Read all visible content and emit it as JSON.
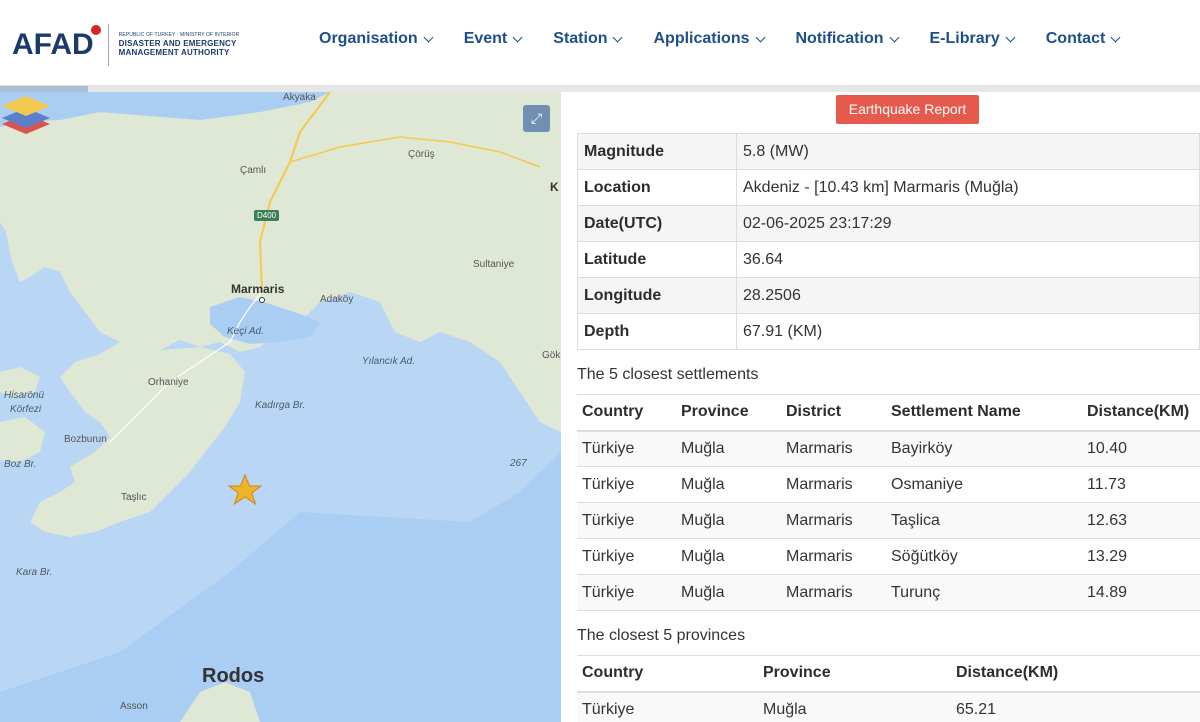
{
  "header": {
    "logo_text": "AFAD",
    "logo_line1": "REPUBLIC OF TURKEY · MINISTRY OF INTERIOR",
    "logo_line2": "DISASTER AND EMERGENCY",
    "logo_line3": "MANAGEMENT AUTHORITY",
    "nav": [
      "Organisation",
      "Event",
      "Station",
      "Applications",
      "Notification",
      "E-Library",
      "Contact"
    ]
  },
  "map": {
    "labels": {
      "akyaka": "Akyaka",
      "corus": "Çörüş",
      "camli": "Çamlı",
      "d400": "D400",
      "marmaris": "Marmaris",
      "adakoy": "Adaköy",
      "sultaniye": "Sultaniye",
      "keci": "Keçi Ad.",
      "yilancik": "Yılancık Ad.",
      "gok": "Gök",
      "orhaniye": "Orhaniye",
      "hisaronu1": "Hisarönü",
      "hisaronu2": "Körfezi",
      "kadirga": "Kadırga Br.",
      "bozburun": "Bozburun",
      "bozbr": "Boz Br.",
      "taslic": "Taşlıc",
      "depth267": "267",
      "karabr": "Kara Br.",
      "rodos": "Rodos",
      "asson": "Asson",
      "k": "K"
    },
    "expand_icon": "expand-icon",
    "layers_icon": "layers-icon",
    "epicenter_icon": "star-icon",
    "colors": {
      "sea": "#a9cdf3",
      "land": "#dfe7d5",
      "road": "#f6c94a",
      "star": "#f0b429"
    }
  },
  "panel": {
    "report_button": "Earthquake Report",
    "info": [
      {
        "key": "Magnitude",
        "value": "5.8 (MW)"
      },
      {
        "key": "Location",
        "value": "Akdeniz - [10.43 km] Marmaris (Muğla)"
      },
      {
        "key": "Date(UTC)",
        "value": "02-06-2025 23:17:29"
      },
      {
        "key": "Latitude",
        "value": "36.64"
      },
      {
        "key": "Longitude",
        "value": "28.2506"
      },
      {
        "key": "Depth",
        "value": "67.91 (KM)"
      }
    ],
    "settlements_title": "The 5 closest settlements",
    "settlements_headers": [
      "Country",
      "Province",
      "District",
      "Settlement Name",
      "Distance(KM)"
    ],
    "settlements": [
      [
        "Türkiye",
        "Muğla",
        "Marmaris",
        "Bayirköy",
        "10.40"
      ],
      [
        "Türkiye",
        "Muğla",
        "Marmaris",
        "Osmaniye",
        "11.73"
      ],
      [
        "Türkiye",
        "Muğla",
        "Marmaris",
        "Taşlica",
        "12.63"
      ],
      [
        "Türkiye",
        "Muğla",
        "Marmaris",
        "Söğütköy",
        "13.29"
      ],
      [
        "Türkiye",
        "Muğla",
        "Marmaris",
        "Turunç",
        "14.89"
      ]
    ],
    "provinces_title": "The closest 5 provinces",
    "provinces_headers": [
      "Country",
      "Province",
      "Distance(KM)"
    ],
    "provinces": [
      [
        "Türkiye",
        "Muğla",
        "65.21"
      ]
    ]
  }
}
